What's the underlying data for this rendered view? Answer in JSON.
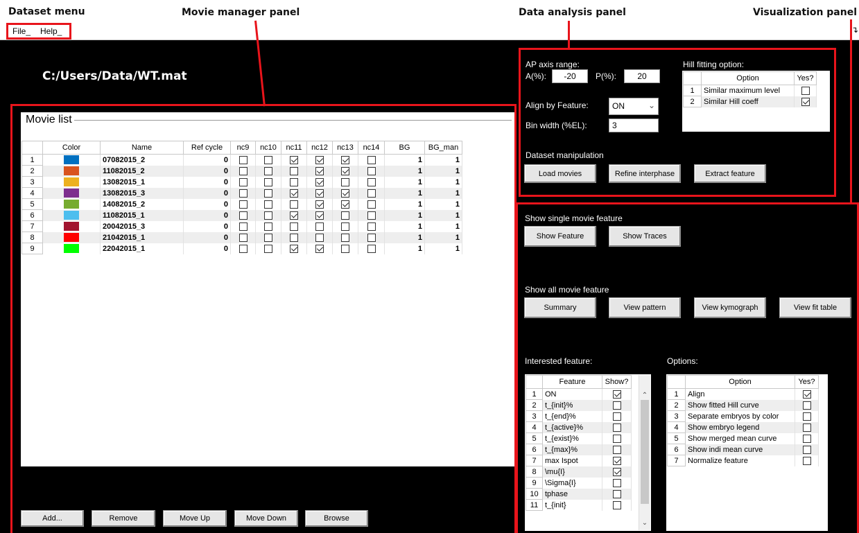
{
  "annotations": {
    "dataset_menu": "Dataset menu",
    "movie_manager": "Movie manager panel",
    "data_analysis": "Data analysis panel",
    "visualization": "Visualization panel"
  },
  "menu": {
    "file": "File_",
    "help": "Help_"
  },
  "dataset_path": "C:/Users/Data/WT.mat",
  "movie_list": {
    "title": "Movie list",
    "columns": [
      "",
      "Color",
      "Name",
      "Ref cycle",
      "nc9",
      "nc10",
      "nc11",
      "nc12",
      "nc13",
      "nc14",
      "BG",
      "BG_man"
    ],
    "rows": [
      {
        "n": "1",
        "color": "#0070c0",
        "name": "07082015_2",
        "ref": "0",
        "nc": [
          false,
          false,
          true,
          true,
          true,
          false
        ],
        "bg": "1",
        "bgman": "1"
      },
      {
        "n": "2",
        "color": "#d9541e",
        "name": "11082015_2",
        "ref": "0",
        "nc": [
          false,
          false,
          false,
          true,
          true,
          false
        ],
        "bg": "1",
        "bgman": "1"
      },
      {
        "n": "3",
        "color": "#edb120",
        "name": "13082015_1",
        "ref": "0",
        "nc": [
          false,
          false,
          false,
          true,
          false,
          false
        ],
        "bg": "1",
        "bgman": "1"
      },
      {
        "n": "4",
        "color": "#7e2f8e",
        "name": "13082015_3",
        "ref": "0",
        "nc": [
          false,
          false,
          true,
          true,
          true,
          false
        ],
        "bg": "1",
        "bgman": "1"
      },
      {
        "n": "5",
        "color": "#77ac30",
        "name": "14082015_2",
        "ref": "0",
        "nc": [
          false,
          false,
          false,
          true,
          true,
          false
        ],
        "bg": "1",
        "bgman": "1"
      },
      {
        "n": "6",
        "color": "#4dbeee",
        "name": "11082015_1",
        "ref": "0",
        "nc": [
          false,
          false,
          true,
          true,
          false,
          false
        ],
        "bg": "1",
        "bgman": "1"
      },
      {
        "n": "7",
        "color": "#a2142f",
        "name": "20042015_3",
        "ref": "0",
        "nc": [
          false,
          false,
          false,
          false,
          false,
          false
        ],
        "bg": "1",
        "bgman": "1"
      },
      {
        "n": "8",
        "color": "#ff0000",
        "name": "21042015_1",
        "ref": "0",
        "nc": [
          false,
          false,
          false,
          false,
          false,
          false
        ],
        "bg": "1",
        "bgman": "1"
      },
      {
        "n": "9",
        "color": "#00ff00",
        "name": "22042015_1",
        "ref": "0",
        "nc": [
          false,
          false,
          true,
          true,
          false,
          false
        ],
        "bg": "1",
        "bgman": "1"
      }
    ]
  },
  "manager_buttons": {
    "add": "Add...",
    "remove": "Remove",
    "move_up": "Move Up",
    "move_down": "Move Down",
    "browse": "Browse"
  },
  "analysis": {
    "ap_label": "AP axis range:",
    "a_label": "A(%):",
    "a_value": "-20",
    "p_label": "P(%):",
    "p_value": "20",
    "align_label": "Align by Feature:",
    "align_value": "ON",
    "bin_label": "Bin width (%EL):",
    "bin_value": "3",
    "hill_label": "Hill fitting option:",
    "hill_columns": [
      "",
      "Option",
      "Yes?"
    ],
    "hill_rows": [
      {
        "n": "1",
        "option": "Similar maximum level",
        "yes": false
      },
      {
        "n": "2",
        "option": "Similar Hill coeff",
        "yes": true
      }
    ],
    "manip_label": "Dataset manipulation",
    "load": "Load movies",
    "refine": "Refine interphase",
    "extract": "Extract feature"
  },
  "visualization": {
    "single_label": "Show single movie feature",
    "show_feature": "Show Feature",
    "show_traces": "Show Traces",
    "all_label": "Show all movie feature",
    "summary": "Summary",
    "view_pattern": "View pattern",
    "view_kymograph": "View kymograph",
    "view_fit": "View fit table",
    "interested_label": "Interested feature:",
    "feature_columns": [
      "",
      "Feature",
      "Show?"
    ],
    "features": [
      {
        "n": "1",
        "name": "ON",
        "show": true
      },
      {
        "n": "2",
        "name": "t_{init}%",
        "show": false
      },
      {
        "n": "3",
        "name": "t_{end}%",
        "show": false
      },
      {
        "n": "4",
        "name": "t_{active}%",
        "show": false
      },
      {
        "n": "5",
        "name": "t_{exist}%",
        "show": false
      },
      {
        "n": "6",
        "name": "t_{max}%",
        "show": false
      },
      {
        "n": "7",
        "name": "max Ispot",
        "show": true
      },
      {
        "n": "8",
        "name": "\\mu{I}",
        "show": true
      },
      {
        "n": "9",
        "name": "\\Sigma{I}",
        "show": false
      },
      {
        "n": "10",
        "name": "tphase",
        "show": false
      },
      {
        "n": "11",
        "name": "t_{init}",
        "show": false
      }
    ],
    "options_label": "Options:",
    "option_columns": [
      "",
      "Option",
      "Yes?"
    ],
    "options": [
      {
        "n": "1",
        "name": "Align",
        "yes": true
      },
      {
        "n": "2",
        "name": "Show fitted Hill curve",
        "yes": false
      },
      {
        "n": "3",
        "name": "Separate embryos by color",
        "yes": false
      },
      {
        "n": "4",
        "name": "Show embryo legend",
        "yes": false
      },
      {
        "n": "5",
        "name": "Show merged mean curve",
        "yes": false
      },
      {
        "n": "6",
        "name": "Show indi mean curve",
        "yes": false
      },
      {
        "n": "7",
        "name": "Normalize feature",
        "yes": false
      }
    ]
  },
  "colors": {
    "annotation_red": "#e8141b",
    "app_background": "#000000"
  }
}
